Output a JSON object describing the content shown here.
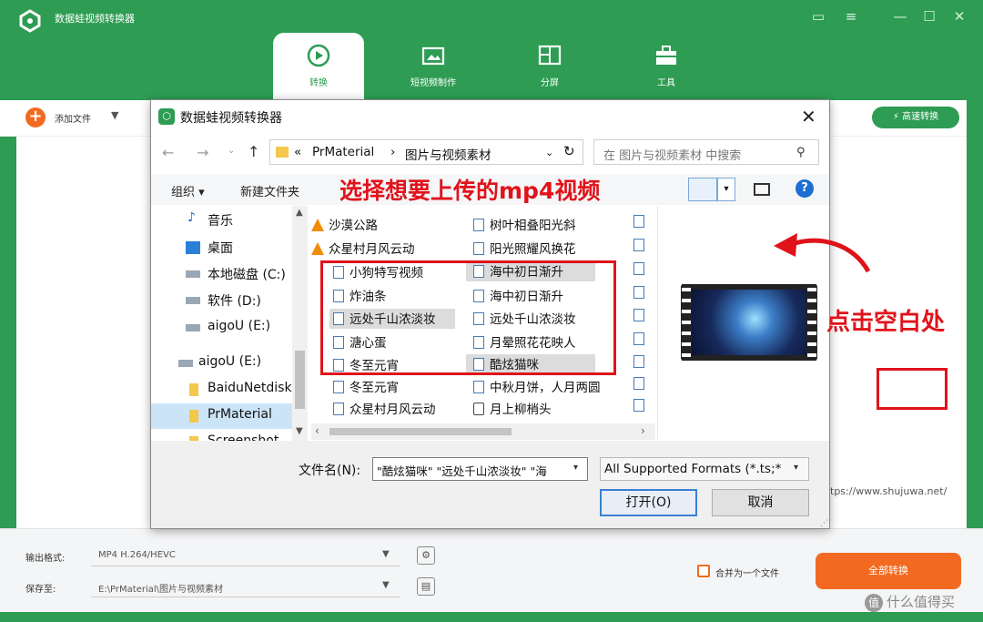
{
  "app": {
    "title": "数据蛙视频转换器",
    "tabs": [
      {
        "label": "转换",
        "icon": "convert-icon"
      },
      {
        "label": "短视频制作",
        "icon": "video-maker-icon"
      },
      {
        "label": "分屏",
        "icon": "split-screen-icon"
      },
      {
        "label": "工具",
        "icon": "toolbox-icon"
      }
    ],
    "add_file_label": "添加文件",
    "fast_convert_label": "高速转换",
    "output_format_label": "输出格式:",
    "output_format_value": "MP4 H.264/HEVC",
    "save_to_label": "保存至:",
    "save_to_value": "E:\\PrMaterial\\图片与视频素材",
    "merge_label": "合并为一个文件",
    "convert_all_label": "全部转换",
    "url_text": "tps://www.shujuwa.net/",
    "watermark": "什么值得买",
    "brand_color": "#2e9c53",
    "accent_color": "#f26a21"
  },
  "dialog": {
    "title": "数据蛙视频转换器",
    "breadcrumb": [
      "«",
      "PrMaterial",
      "›",
      "图片与视频素材"
    ],
    "search_placeholder": "在 图片与视频素材 中搜索",
    "organize_label": "组织 ▾",
    "new_folder_label": "新建文件夹",
    "nav_items": [
      {
        "label": "音乐",
        "icon": "music-icon"
      },
      {
        "label": "桌面",
        "icon": "desktop-icon"
      },
      {
        "label": "本地磁盘 (C:)",
        "icon": "drive-icon"
      },
      {
        "label": "软件 (D:)",
        "icon": "drive-icon"
      },
      {
        "label": "aigoU (E:)",
        "icon": "drive-icon"
      },
      {
        "label": "aigoU (E:)",
        "icon": "drive-icon"
      },
      {
        "label": "BaiduNetdisk",
        "icon": "folder-icon"
      },
      {
        "label": "PrMaterial",
        "icon": "folder-icon"
      },
      {
        "label": "Screenshot",
        "icon": "folder-icon"
      }
    ],
    "files_col1": [
      "沙漠公路",
      "众星村月风云动",
      "小狗特写视频",
      "炸油条",
      "远处千山浓淡妆",
      "溏心蛋",
      "冬至元宵",
      "冬至元宵",
      "众星村月风云动"
    ],
    "files_col2": [
      "树叶相叠阳光斜",
      "阳光照耀风换花",
      "海中初日渐升",
      "海中初日渐升",
      "远处千山浓淡妆",
      "月晕照花花映人",
      "酷炫猫咪",
      "中秋月饼，人月两圆",
      "月上柳梢头"
    ],
    "filename_label": "文件名(N):",
    "filename_value": "\"酷炫猫咪\" \"远处千山浓淡妆\" \"海",
    "format_value": "All Supported Formats (*.ts;*",
    "open_label": "打开(O)",
    "cancel_label": "取消"
  },
  "annotations": {
    "select_hint": "选择想要上传的mp4视频",
    "click_hint": "点击空白处"
  }
}
